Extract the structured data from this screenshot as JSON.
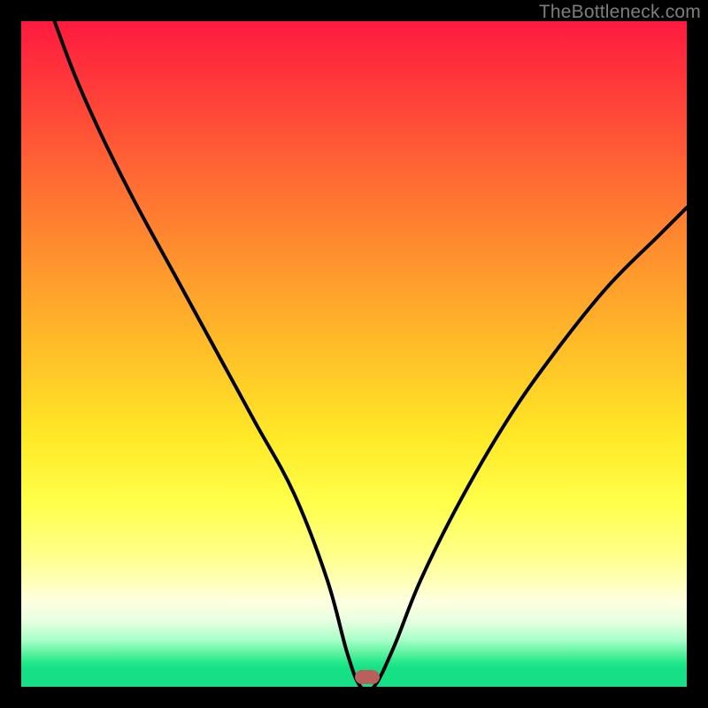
{
  "watermark": "TheBottleneck.com",
  "marker": {
    "x_frac": 0.52,
    "y_frac": 0.985,
    "color": "#b9605c"
  },
  "chart_data": {
    "type": "line",
    "title": "",
    "xlabel": "",
    "ylabel": "",
    "xlim": [
      0,
      100
    ],
    "ylim": [
      0,
      100
    ],
    "grid": false,
    "legend": false,
    "series": [
      {
        "name": "bottleneck-curve",
        "x": [
          5,
          8,
          12,
          17,
          23,
          29,
          35,
          41,
          46,
          49,
          51,
          53,
          56,
          60,
          66,
          73,
          80,
          88,
          96,
          100
        ],
        "y": [
          100,
          92,
          83,
          73,
          62,
          51,
          40,
          29,
          16,
          5,
          0,
          0,
          6,
          16,
          28,
          40,
          50,
          60,
          68,
          72
        ]
      }
    ],
    "annotations": [
      {
        "type": "marker",
        "x": 52,
        "y": 1.5,
        "label": "optimal-point"
      }
    ],
    "background_gradient": {
      "stops": [
        {
          "pos": 0.0,
          "color": "#ff1a3f"
        },
        {
          "pos": 0.5,
          "color": "#ffc327"
        },
        {
          "pos": 0.8,
          "color": "#ffff8a"
        },
        {
          "pos": 0.98,
          "color": "#22e88a"
        }
      ]
    }
  }
}
